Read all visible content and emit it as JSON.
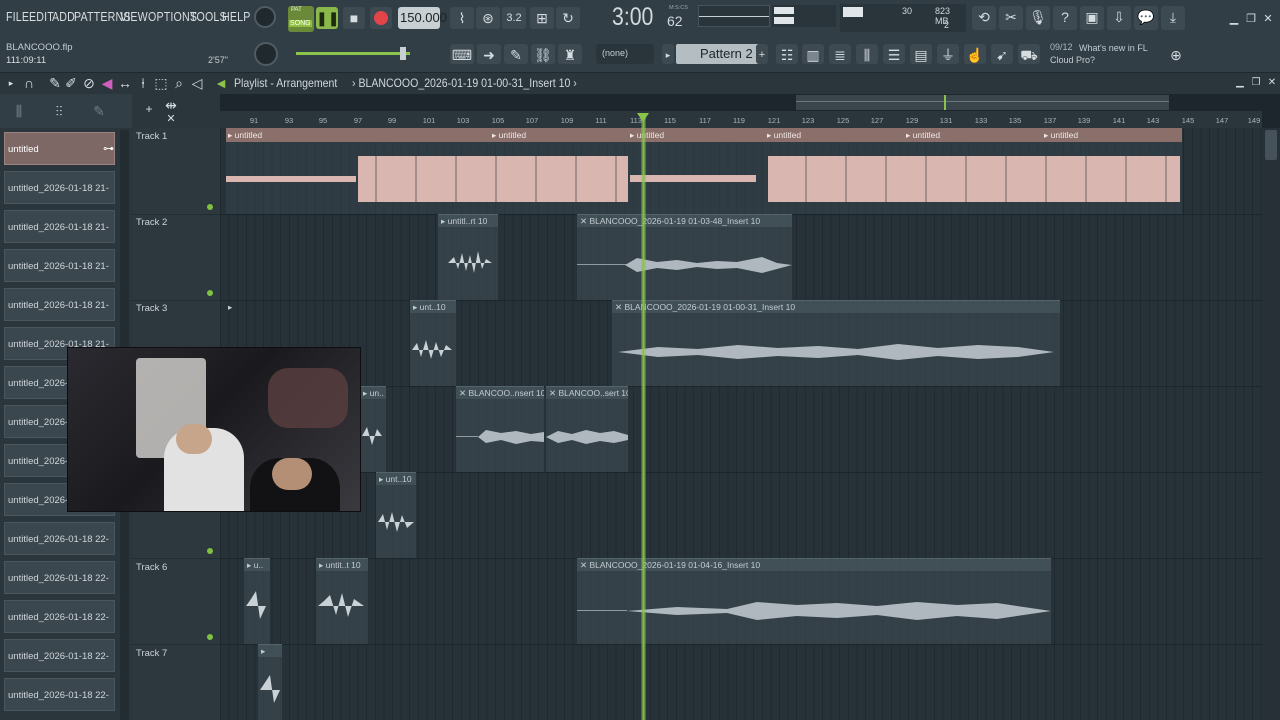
{
  "menu": [
    "FILE",
    "EDIT",
    "ADD",
    "PATTERNS",
    "VIEW",
    "OPTIONS",
    "TOOLS",
    "HELP"
  ],
  "transport": {
    "mode_label": "SONG",
    "pat_label": "PAT",
    "tempo": "150.000",
    "time": "3:00",
    "time_sub": "62",
    "time_unit": "M:S:CS",
    "cpu": "30",
    "mem": "823 MB",
    "poly": "2",
    "snap": "(none)",
    "pattern": "Pattern 2"
  },
  "project": {
    "file": "BLANCOOO.flp",
    "clock": "111:09:11",
    "length": "2'57\""
  },
  "news": {
    "count": "09/12",
    "text": "What's new in FL Cloud Pro?"
  },
  "playlist": {
    "title": "Playlist - Arrangement",
    "breadcrumb": "BLANCOOO_2026-01-19 01-00-31_Insert 10"
  },
  "browser": [
    "untitled",
    "untitled_2026-01-18 21-",
    "untitled_2026-01-18 21-",
    "untitled_2026-01-18 21-",
    "untitled_2026-01-18 21-",
    "untitled_2026-01-18 21-",
    "untitled_2026-0",
    "untitled_2026-0",
    "untitled_2026-0",
    "untitled_2026-0",
    "untitled_2026-01-18 22-",
    "untitled_2026-01-18 22-",
    "untitled_2026-01-18 22-",
    "untitled_2026-01-18 22-",
    "untitled_2026-01-18 22-"
  ],
  "ruler": [
    "91",
    "93",
    "95",
    "97",
    "99",
    "101",
    "103",
    "105",
    "107",
    "109",
    "111",
    "113",
    "115",
    "117",
    "119",
    "121",
    "123",
    "125",
    "127",
    "129",
    "131",
    "133",
    "135",
    "137",
    "139",
    "141",
    "143",
    "145",
    "147",
    "149"
  ],
  "tracks": [
    "Track 1",
    "Track 2",
    "Track 3",
    "",
    "",
    "Track 6",
    "Track 7"
  ],
  "clips": {
    "t1": [
      "untitled",
      "untitled",
      "untitled",
      "untitled",
      "untitled",
      "untitled"
    ],
    "t2": [
      "untitl..rt 10",
      "BLANCOOO_2026-01-19 01-03-48_Insert 10"
    ],
    "t3": [
      "unt..10",
      "BLANCOOO_2026-01-19 01-00-31_Insert 10"
    ],
    "t4": [
      "un..",
      "BLANCOO..nsert 10",
      "BLANCOO..sert 10"
    ],
    "t5": [
      "unt..10"
    ],
    "t6": [
      "u..",
      "untit..t 10",
      "BLANCOOO_2026-01-19 01-04-16_Insert 10"
    ]
  },
  "colors": {
    "accent": "#8ac44a",
    "clip_pink": "#d9b6b0",
    "bg": "#263138"
  }
}
